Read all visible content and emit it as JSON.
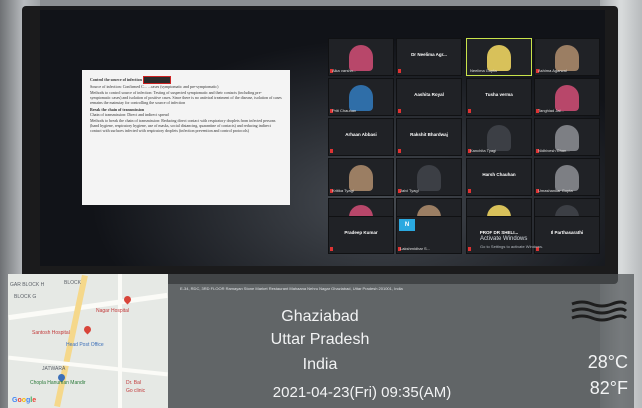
{
  "slide": {
    "heading_1": "Control the source of infection",
    "heading_2": "Break the chain of transmission",
    "lines_1": [
      "Source of infection: Confirmed C... ...cases (symptomatic and pre-symptomatic)",
      "Methods to control source of infection: Testing of suspected symptomatic and their contacts (including pre-symptomatic cases) and isolation of positive cases. Since there is no antiviral treatment of the disease, isolation of cases remains the mainstay for controlling the source of infection"
    ],
    "lines_2": [
      "Chain of transmission: Direct and indirect spread",
      "Methods to break the chain of transmission: Reducing direct contact with respiratory droplets from infected persons (hand hygiene, respiratory hygiene, use of masks, social distancing, quarantine of contacts) and reducing indirect contact with surfaces infected with respiratory droplets (infection prevention and control protocols)"
    ]
  },
  "participants": [
    {
      "name": "Alka varshn..."
    },
    {
      "name": "Dr Neelima Agr..."
    },
    {
      "name": "Neelima Gupta"
    },
    {
      "name": "Ashima Agarwal"
    },
    {
      "name": "Priti Chauhan"
    },
    {
      "name": "Aashita Royal"
    },
    {
      "name": "Tusha verma"
    },
    {
      "name": "Tanghiad Jai..."
    },
    {
      "name": "Arhaan Abbasi"
    },
    {
      "name": "Rakshit Bhardwaj"
    },
    {
      "name": "Kanchita Tyagi"
    },
    {
      "name": "Nidhivesh Chan..."
    },
    {
      "name": "Kritika Tyagi"
    },
    {
      "name": "Jaivi Tyagi"
    },
    {
      "name": "Harsh Chauhan"
    },
    {
      "name": "Umashankar Gupta"
    },
    {
      "name": "Connecting to..."
    },
    {
      "name": "Shivansh..."
    },
    {
      "name": "Gobardhan..."
    },
    {
      "name": "Khushi Gupta"
    },
    {
      "name": "Pradeep Kumar"
    },
    {
      "name": "Lakshmidhar S..."
    },
    {
      "name": "PROF DR SHELI..."
    },
    {
      "name": "Il Parthasarathi"
    }
  ],
  "zoom_tile_label": "N",
  "windows_notice": {
    "title": "Activate Windows",
    "subtitle": "Go to Settings to activate Windows."
  },
  "address_line": "E-34, RDC, 3RD FLOOR Ramayan Stone Market Restaurant Mahaana Nehru Nagar Ghaziabad, Uttar Pradesh 201001, India",
  "location": {
    "city": "Ghaziabad",
    "state": "Uttar Pradesh",
    "country": "India"
  },
  "datetime": "2021-04-23(Fri)   09:35(AM)",
  "weather": {
    "icon": "haze-icon",
    "temp_c": "28°C",
    "temp_f": "82°F"
  },
  "map": {
    "labels": {
      "gar_block": "GAR BLOCK H",
      "block": "BLOCK",
      "block_g": "BLOCK G",
      "nagar_hospital": "Nagar Hospital",
      "santosh_hospital": "Santosh Hospital",
      "head_post_office": "Head Post Office",
      "jatwara": "JATWARA",
      "chopla": "Chopla Hanuman Mandir",
      "dr_bal": "Dr. Bal",
      "go_clinic": "Go clinic"
    },
    "google": "Google",
    "colors": {
      "pin": "#d8453a",
      "road_major": "#f5d88b"
    }
  }
}
